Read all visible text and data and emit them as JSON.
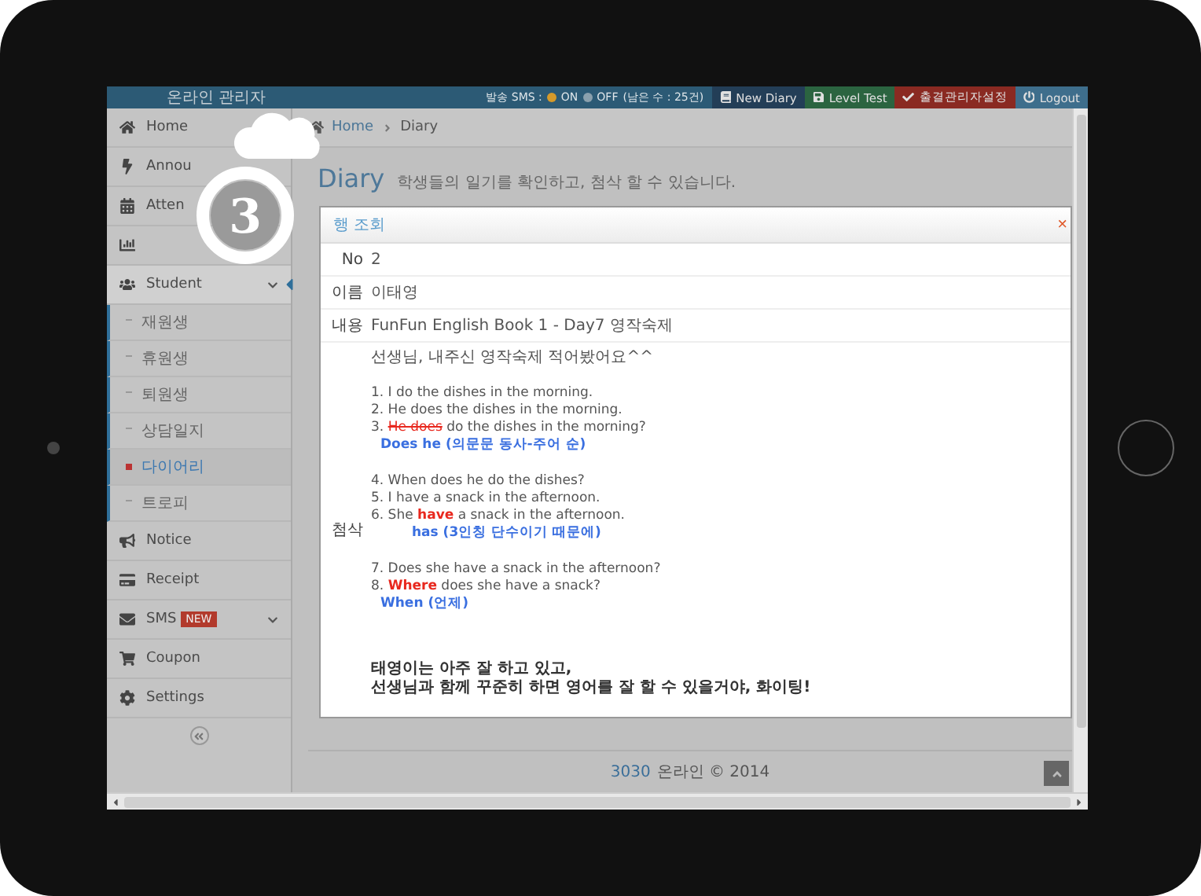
{
  "topbar": {
    "title": "온라인 관리자",
    "sms_label": "발송 SMS :",
    "sms_options": [
      {
        "label": "ON",
        "selected": true
      },
      {
        "label": "OFF",
        "selected": false
      }
    ],
    "sms_note": "(남은 수 : 25건)",
    "buttons": [
      {
        "label": "New Diary",
        "kind": "diary"
      },
      {
        "label": "Level Test",
        "kind": "level"
      },
      {
        "label": "출결관리자설정",
        "kind": "attend"
      },
      {
        "label": "Logout",
        "kind": "logout"
      }
    ]
  },
  "sidebar": {
    "items": [
      {
        "kind": "link",
        "label": "Home",
        "selected": false
      },
      {
        "kind": "link",
        "label": "Annou",
        "selected": false
      },
      {
        "kind": "link",
        "label": "Atten",
        "selected": false
      },
      {
        "kind": "group",
        "selected": false
      },
      {
        "kind": "group",
        "label": "Student",
        "selected": true,
        "expanded": true,
        "children": [
          {
            "label": "재원생",
            "selected": false
          },
          {
            "label": "휴원생",
            "selected": false
          },
          {
            "label": "퇴원생",
            "selected": false
          },
          {
            "label": "상담일지",
            "selected": false
          },
          {
            "label": "다이어리",
            "selected": true
          },
          {
            "label": "트로피",
            "selected": false
          }
        ]
      },
      {
        "kind": "link",
        "label": "Notice",
        "selected": false
      },
      {
        "kind": "link",
        "label": "Receipt",
        "selected": false
      },
      {
        "kind": "group",
        "label": "SMS",
        "badge": "NEW",
        "selected": false
      },
      {
        "kind": "link",
        "label": "Coupon",
        "selected": false
      },
      {
        "kind": "link",
        "label": "Settings",
        "selected": false
      }
    ]
  },
  "breadcrumb": [
    "Home",
    "Diary"
  ],
  "page": {
    "title": "Diary",
    "subtitle": "학생들의 일기를 확인하고, 첨삭 할 수 있습니다."
  },
  "callout": {
    "number": "3"
  },
  "modal": {
    "title": "행 조회",
    "close": "×",
    "fields": [
      {
        "label": "No",
        "value": "2"
      },
      {
        "label": "이름",
        "value": "이태영"
      },
      {
        "label": "내용",
        "value": "FunFun English Book 1 - Day7 영작숙제"
      }
    ],
    "review_label": "첨삭",
    "review": [
      [
        {
          "kind": "indent",
          "text": "선생님, 내주신 영작숙제 적어봤어요^^"
        }
      ],
      [
        {
          "kind": "gap"
        }
      ],
      [
        {
          "kind": "plain",
          "text": "1. I do the dishes in the morning."
        }
      ],
      [
        {
          "kind": "plain",
          "text": "2. He does the dishes in the morning."
        }
      ],
      [
        {
          "kind": "plain",
          "text": "3. "
        },
        {
          "kind": "strike",
          "text": "He does"
        },
        {
          "kind": "plain",
          "text": " do the dishes in the morning?"
        }
      ],
      [
        {
          "kind": "fix",
          "text": "Does he (의문문 동사-주어 순)"
        }
      ],
      [
        {
          "kind": "gap"
        }
      ],
      [
        {
          "kind": "plain",
          "text": "4. When does he do the dishes?"
        }
      ],
      [
        {
          "kind": "plain",
          "text": "5. I have a snack in the afternoon."
        }
      ],
      [
        {
          "kind": "plain",
          "text": "6. She "
        },
        {
          "kind": "wrong",
          "text": "have"
        },
        {
          "kind": "plain",
          "text": " a snack in the afternoon."
        }
      ],
      [
        {
          "kind": "fixwide",
          "text": "has (3인칭 단수이기 때문에)"
        }
      ],
      [
        {
          "kind": "gap"
        }
      ],
      [
        {
          "kind": "plain",
          "text": "7. Does she have a snack in the afternoon?"
        }
      ],
      [
        {
          "kind": "plain",
          "text": "8. "
        },
        {
          "kind": "wrong",
          "text": "Where"
        },
        {
          "kind": "plain",
          "text": " does she have a snack?"
        }
      ],
      [
        {
          "kind": "fix",
          "text": "When (언제)"
        }
      ]
    ],
    "comment": [
      "태영이는 아주 잘 하고 있고,",
      "선생님과 함께 꾸준히 하면 영어를 잘 할 수 있을거야, 화이팅!"
    ]
  },
  "footer": {
    "brand": "3030",
    "text": "온라인 © 2014"
  }
}
